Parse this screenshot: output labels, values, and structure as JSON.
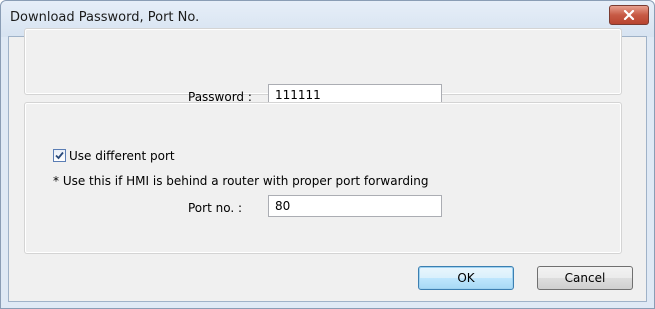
{
  "window": {
    "title": "Download Password, Port No."
  },
  "password": {
    "label": "Password :",
    "value": "111111"
  },
  "port": {
    "use_different_label": "Use different port",
    "use_different_checked": true,
    "note": "* Use this if HMI is behind a router with proper port forwarding",
    "label": "Port no. :",
    "value": "80"
  },
  "buttons": {
    "ok_label": "OK",
    "cancel_label": "Cancel"
  },
  "icons": {
    "close": "close-icon",
    "check": "check-icon"
  },
  "colors": {
    "close_button": "#c75a45",
    "default_button_border": "#3c7fb1",
    "checkbox_border": "#5a7db4"
  }
}
